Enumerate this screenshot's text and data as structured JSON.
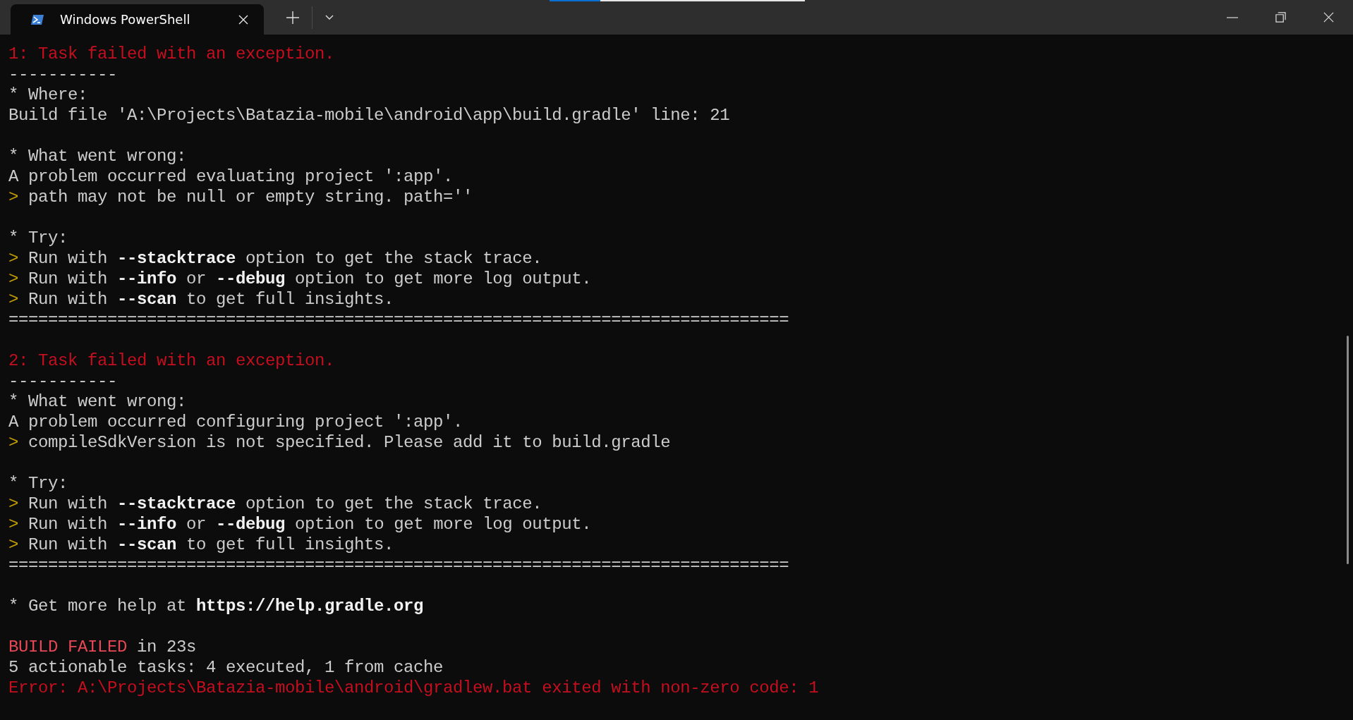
{
  "window": {
    "tab": {
      "title": "Windows PowerShell",
      "selected": true
    }
  },
  "top_indicator": {
    "level": 0.2
  },
  "terminal": {
    "lines": [
      {
        "parts": [
          {
            "kind": "red",
            "text": "1: Task failed with an exception."
          }
        ]
      },
      {
        "parts": [
          {
            "kind": "plain",
            "text": "-----------"
          }
        ]
      },
      {
        "parts": [
          {
            "kind": "plain",
            "text": "* Where:"
          }
        ]
      },
      {
        "parts": [
          {
            "kind": "plain",
            "text": "Build file 'A:\\Projects\\Batazia-mobile\\android\\app\\build.gradle' line: 21"
          }
        ]
      },
      {
        "kind": "blank"
      },
      {
        "parts": [
          {
            "kind": "plain",
            "text": "* What went wrong:"
          }
        ]
      },
      {
        "parts": [
          {
            "kind": "plain",
            "text": "A problem occurred evaluating project ':app'."
          }
        ]
      },
      {
        "parts": [
          {
            "kind": "yellow",
            "text": ">"
          },
          {
            "kind": "plain",
            "text": " path may not be null or empty string. path=''"
          }
        ]
      },
      {
        "kind": "blank"
      },
      {
        "parts": [
          {
            "kind": "plain",
            "text": "* Try:"
          }
        ]
      },
      {
        "parts": [
          {
            "kind": "yellow",
            "text": ">"
          },
          {
            "kind": "plain",
            "text": " Run with **--stacktrace** option to get the stack trace."
          }
        ]
      },
      {
        "parts": [
          {
            "kind": "yellow",
            "text": ">"
          },
          {
            "kind": "plain",
            "text": " Run with **--info** or **--debug** option to get more log output."
          }
        ]
      },
      {
        "parts": [
          {
            "kind": "yellow",
            "text": ">"
          },
          {
            "kind": "plain",
            "text": " Run with **--scan** to get full insights."
          }
        ]
      },
      {
        "parts": [
          {
            "kind": "plain",
            "text": "==============================================================================="
          }
        ]
      },
      {
        "kind": "blank"
      },
      {
        "parts": [
          {
            "kind": "red",
            "text": "2: Task failed with an exception."
          }
        ]
      },
      {
        "parts": [
          {
            "kind": "plain",
            "text": "-----------"
          }
        ]
      },
      {
        "parts": [
          {
            "kind": "plain",
            "text": "* What went wrong:"
          }
        ]
      },
      {
        "parts": [
          {
            "kind": "plain",
            "text": "A problem occurred configuring project ':app'."
          }
        ]
      },
      {
        "parts": [
          {
            "kind": "yellow",
            "text": ">"
          },
          {
            "kind": "plain",
            "text": " compileSdkVersion is not specified. Please add it to build.gradle"
          }
        ]
      },
      {
        "kind": "blank"
      },
      {
        "parts": [
          {
            "kind": "plain",
            "text": "* Try:"
          }
        ]
      },
      {
        "parts": [
          {
            "kind": "yellow",
            "text": ">"
          },
          {
            "kind": "plain",
            "text": " Run with **--stacktrace** option to get the stack trace."
          }
        ]
      },
      {
        "parts": [
          {
            "kind": "yellow",
            "text": ">"
          },
          {
            "kind": "plain",
            "text": " Run with **--info** or **--debug** option to get more log output."
          }
        ]
      },
      {
        "parts": [
          {
            "kind": "yellow",
            "text": ">"
          },
          {
            "kind": "plain",
            "text": " Run with **--scan** to get full insights."
          }
        ]
      },
      {
        "parts": [
          {
            "kind": "plain",
            "text": "==============================================================================="
          }
        ]
      },
      {
        "kind": "blank"
      },
      {
        "parts": [
          {
            "kind": "plain",
            "text": "* Get more help at **https://help.gradle.org**"
          }
        ]
      },
      {
        "kind": "blank"
      },
      {
        "parts": [
          {
            "kind": "bright_red",
            "text": "BUILD FAILED"
          },
          {
            "kind": "plain",
            "text": " in 23s"
          }
        ]
      },
      {
        "parts": [
          {
            "kind": "plain",
            "text": "5 actionable tasks: 4 executed, 1 from cache"
          }
        ]
      },
      {
        "parts": [
          {
            "kind": "red",
            "text": "Error: A:\\Projects\\Batazia-mobile\\android\\gradlew.bat exited with non-zero code: 1"
          }
        ]
      }
    ]
  }
}
